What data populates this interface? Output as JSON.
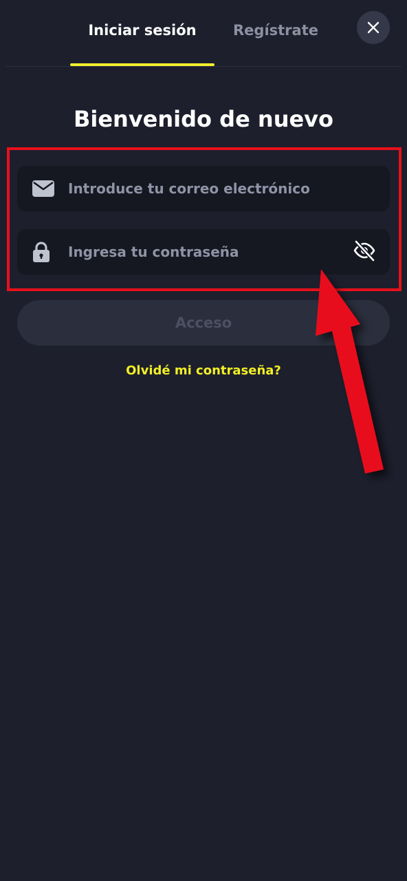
{
  "tabs": [
    {
      "label": "Iniciar sesión",
      "active": true
    },
    {
      "label": "Regístrate",
      "active": false
    }
  ],
  "close_icon": "close-icon",
  "title": "Bienvenido de nuevo",
  "form": {
    "email": {
      "icon": "envelope-icon",
      "placeholder": "Introduce tu correo electrónico",
      "value": ""
    },
    "password": {
      "icon": "lock-icon",
      "placeholder": "Ingresa tu contraseña",
      "value": "",
      "toggle_icon": "eye-slash-icon"
    },
    "submit_label": "Acceso",
    "forgot_label": "Olvidé mi contraseña?"
  },
  "colors": {
    "background": "#1d1f2d",
    "accent": "#f3ef2e",
    "annotation_red": "#e8101b",
    "input_bg": "#151721",
    "button_disabled_bg": "#2b2f3d"
  }
}
